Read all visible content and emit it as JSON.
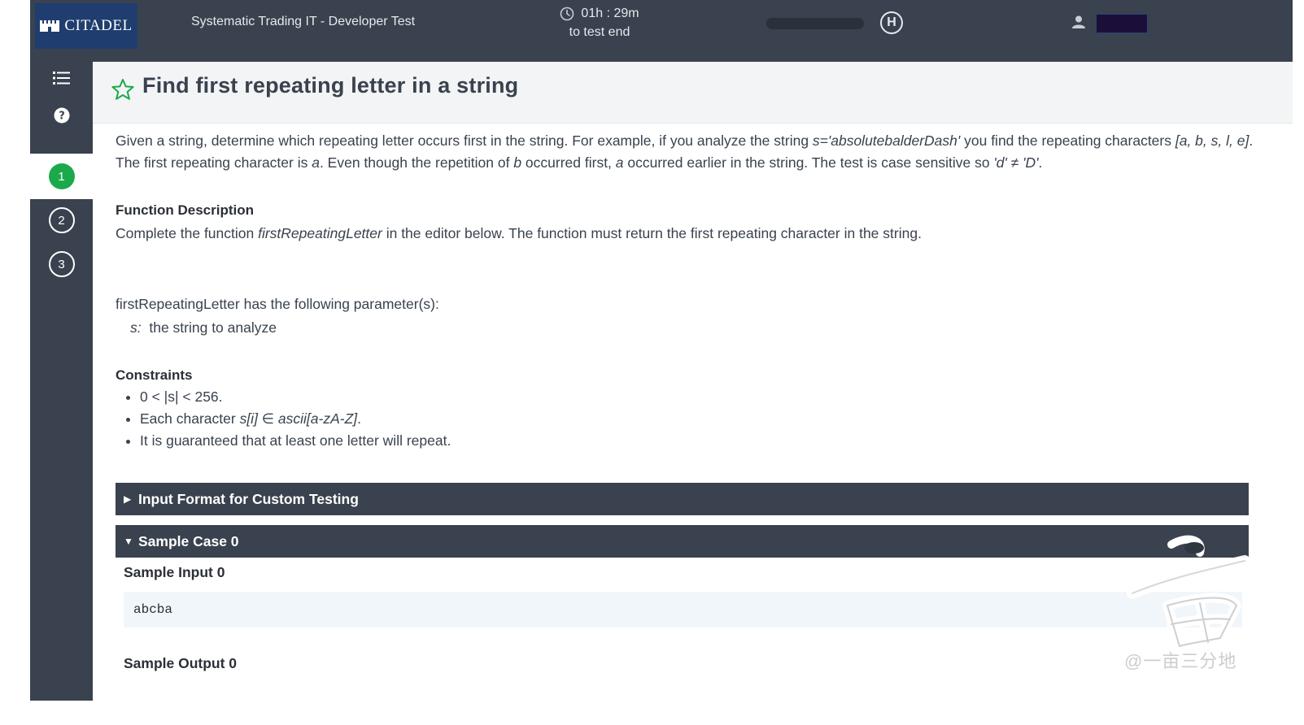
{
  "header": {
    "brand": "CITADEL",
    "test_title": "Systematic Trading IT - Developer Test",
    "timer_value": "01h : 29m",
    "timer_caption": "to test end",
    "hackerrank_mark": "H"
  },
  "sidebar": {
    "questions": [
      {
        "number": "1",
        "state": "active"
      },
      {
        "number": "2",
        "state": "idle"
      },
      {
        "number": "3",
        "state": "idle"
      }
    ]
  },
  "problem": {
    "title": "Find first repeating letter in a string",
    "intro_a": "Given a string, determine which repeating letter occurs first in the string. For example, if you analyze the string ",
    "intro_expr": "s='absolutebalderDash'",
    "intro_b": " you find the repeating characters ",
    "intro_list": "[a, b, s, l, e]",
    "intro_c": ". The first repeating character is ",
    "intro_var_a": "a",
    "intro_d": ". Even though the repetition of ",
    "intro_var_b": "b",
    "intro_e": " occurred first, ",
    "intro_var_a2": "a",
    "intro_f": " occurred earlier in the string. The test is case sensitive so ",
    "intro_neq": "'d' ≠ 'D'",
    "intro_g": ".",
    "fd_heading": "Function Description",
    "fd_a": "Complete the function ",
    "fd_fn": "firstRepeatingLetter",
    "fd_b": " in the editor below. The function must return the first repeating character in the string.",
    "params_intro": "firstRepeatingLetter has the following parameter(s):",
    "param_name": "s:",
    "param_desc": "  the string to analyze",
    "constraints_heading": "Constraints",
    "c1": "0 < |s| < 256.",
    "c2_a": "Each character ",
    "c2_b": "s[i] ∈ ascii[a-zA-Z]",
    "c2_c": ".",
    "c3": "It is guaranteed that at least one letter will repeat."
  },
  "sections": {
    "input_format": "Input Format for Custom Testing",
    "input_format_arrow": "▶",
    "sample_case": "Sample Case 0",
    "sample_case_arrow": "▼",
    "sample_input_label": "Sample Input 0",
    "sample_input_value": "abcba",
    "sample_output_label": "Sample Output 0"
  },
  "watermark": {
    "text": "@一亩三分地"
  },
  "colors": {
    "topbar": "#39424e",
    "logo_bg": "#1f3d6e",
    "active_question": "#1ba94c",
    "star": "#1ba94c",
    "code_bg": "#f1f6fb"
  },
  "icons": [
    "citadel-castle-icon",
    "clock-icon",
    "hackerrank-icon",
    "user-icon",
    "list-icon",
    "help-icon",
    "star-icon"
  ]
}
